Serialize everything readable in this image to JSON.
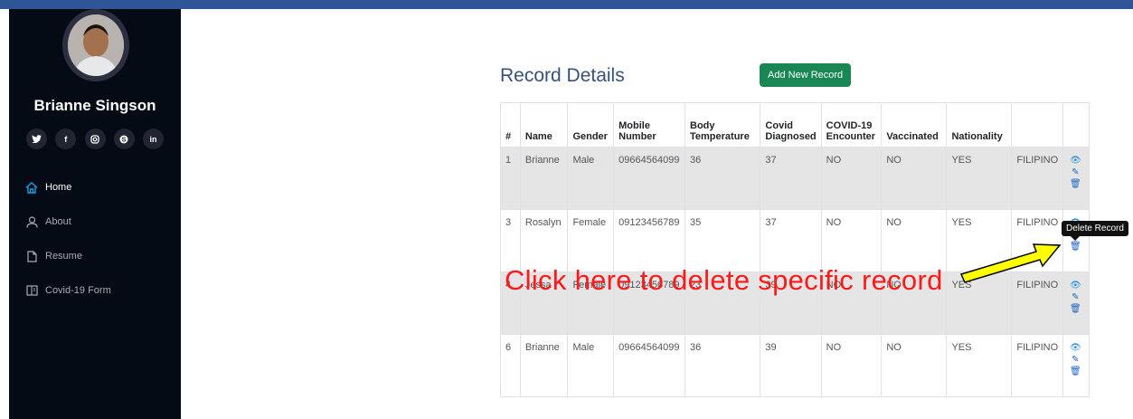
{
  "sidebar": {
    "profile_name": "Brianne Singson",
    "socials": [
      "twitter-icon",
      "facebook-icon",
      "instagram-icon",
      "skype-icon",
      "linkedin-icon"
    ],
    "nav": [
      {
        "label": "Home",
        "icon": "home-icon",
        "active": true
      },
      {
        "label": "About",
        "icon": "user-icon",
        "active": false
      },
      {
        "label": "Resume",
        "icon": "file-icon",
        "active": false
      },
      {
        "label": "Covid-19 Form",
        "icon": "form-icon",
        "active": false
      }
    ]
  },
  "main": {
    "title": "Record Details",
    "add_button": "Add New Record",
    "columns": [
      "#",
      "Name",
      "Gender",
      "Mobile Number",
      "Body Temperature",
      "Covid Diagnosed",
      "COVID-19 Encounter",
      "Vaccinated",
      "Nationality",
      ""
    ],
    "rows": [
      [
        "1",
        "Brianne",
        "Male",
        "09664564099",
        "36",
        "37",
        "NO",
        "NO",
        "YES",
        "FILIPINO"
      ],
      [
        "3",
        "Rosalyn",
        "Female",
        "09123456789",
        "35",
        "37",
        "NO",
        "NO",
        "YES",
        "FILIPINO"
      ],
      [
        "4",
        "Jessa",
        "Female",
        "09123456789",
        "23",
        "39",
        "NO",
        "NO",
        "YES",
        "FILIPINO"
      ],
      [
        "6",
        "Brianne",
        "Male",
        "09664564099",
        "36",
        "39",
        "NO",
        "NO",
        "YES",
        "FILIPINO"
      ]
    ],
    "tooltip": "Delete Record"
  },
  "annotation": "Click here to delete specific record",
  "colors": {
    "accent": "#149ddd",
    "button": "#198754",
    "annotation": "#ff1a1a",
    "arrow": "#ffff00"
  }
}
